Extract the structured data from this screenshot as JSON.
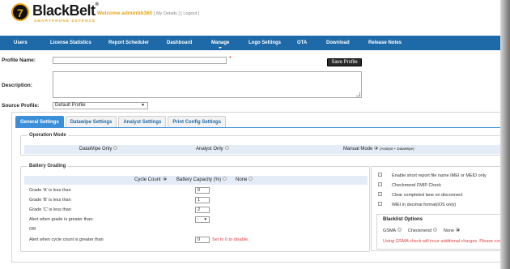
{
  "header": {
    "logo_initial": "7",
    "logo_name": "BlackBelt",
    "logo_mark": "®",
    "logo_tagline": "SMARTPHONE DEFENCE",
    "welcome": "Welcome adminbb360",
    "links": "[ My Details ] [ Logout ]"
  },
  "nav": {
    "items": [
      {
        "label": "Users"
      },
      {
        "label": "License Statistics"
      },
      {
        "label": "Report Scheduler"
      },
      {
        "label": "Dashboard"
      },
      {
        "label": "Manage"
      },
      {
        "label": "Logo Settings"
      },
      {
        "label": "OTA"
      },
      {
        "label": "Download"
      },
      {
        "label": "Release Notes"
      }
    ],
    "active": "Manage"
  },
  "form": {
    "profile_name_label": "Profile Name:",
    "profile_name_value": "",
    "required_mark": "*",
    "save_label": "Save Profile",
    "description_label": "Description:",
    "description_value": "",
    "source_profile_label": "Source Profile:",
    "source_profile_value": "Default Profile"
  },
  "tabs": [
    {
      "label": "General Settings"
    },
    {
      "label": "Datawipe Settings"
    },
    {
      "label": "Analyst Settings"
    },
    {
      "label": "Print Config Settings"
    }
  ],
  "active_tab": "General Settings",
  "operation_mode": {
    "legend": "Operation Mode",
    "options": [
      {
        "label": "DataWipe Only",
        "selected": false
      },
      {
        "label": "Analyst Only",
        "selected": false
      },
      {
        "label": "Manual Mode",
        "selected": true,
        "note": "(Analyst + DataWipe)"
      }
    ]
  },
  "battery_grading": {
    "legend": "Battery Grading",
    "options": [
      {
        "label": "Cycle Count",
        "selected": true
      },
      {
        "label": "Battery Capacity (%)",
        "selected": false
      },
      {
        "label": "None",
        "selected": false
      }
    ],
    "rows": [
      {
        "label": "Grade 'A' is less than",
        "value": "0"
      },
      {
        "label": "Grade 'B' is less than",
        "value": "1"
      },
      {
        "label": "Grade 'C' is less than",
        "value": "2"
      }
    ],
    "alert_grade_label": "Alert when grade is greater than:",
    "alert_grade_value": "-",
    "or_label": "OR",
    "alert_cycle_label": "Alert when cycle count is greater than",
    "alert_cycle_value": "0",
    "alert_cycle_hint": "Set to 0 to disable."
  },
  "options_panel": {
    "checkboxes": [
      {
        "label": "Enable short report file name IMEI or MEID only"
      },
      {
        "label": "Checkmend FMIP Check"
      },
      {
        "label": "Clear completed lane on disconnect"
      },
      {
        "label": "IMEI in decimal format(iOS only)"
      }
    ],
    "blacklist_title": "Blacklist Options",
    "blacklist_options": [
      {
        "label": "GSMA",
        "selected": false
      },
      {
        "label": "Checkmend",
        "selected": false
      },
      {
        "label": "None",
        "selected": true
      }
    ],
    "warning": "Using GSMA check will incur additional charges. Please cor"
  }
}
